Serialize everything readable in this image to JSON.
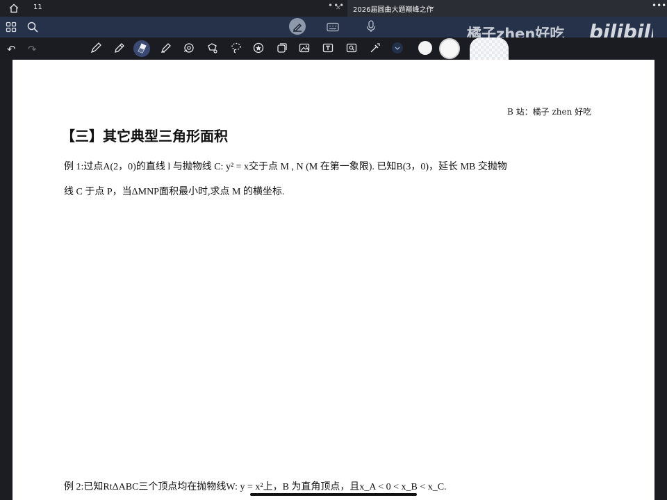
{
  "topbar": {
    "page_count": "11",
    "more": "•••",
    "close": "✕",
    "doc_title": "2026届圆曲大题巅峰之作",
    "doc_chevron": "⌄",
    "window_more": "•••"
  },
  "watermark": {
    "text": "橘子zhen好吃",
    "logo": "bilibili"
  },
  "toolbar": {
    "undo": "↶",
    "redo": "↷",
    "tools": [
      "pen-icon",
      "pencil-icon",
      "eraser-icon",
      "highlighter-icon",
      "shape-icon",
      "lasso-icon",
      "lasso-select-icon",
      "sticker-icon",
      "copy-icon",
      "image-icon",
      "text-icon",
      "image-search-icon",
      "laser-pointer-icon"
    ],
    "colors": [
      "#f4f4f4",
      "#f7f7f7",
      "#eef0f3"
    ]
  },
  "document": {
    "credit": "B 站：橘子 zhen 好吃",
    "section_title": "【三】其它典型三角形面积",
    "example1_line1": "例 1:过点A(2，0)的直线 l 与抛物线 C: y² = x交于点 M , N (M 在第一象限). 已知B(3，0)，延长 MB 交抛物",
    "example1_line2": "线 C 于点 P，当ΔMNP面积最小时,求点 M 的横坐标.",
    "example2_line1": "例 2:已知RtΔABC三个顶点均在抛物线W: y = x²上，B 为直角顶点，且x_A < 0 < x_B < x_C."
  }
}
